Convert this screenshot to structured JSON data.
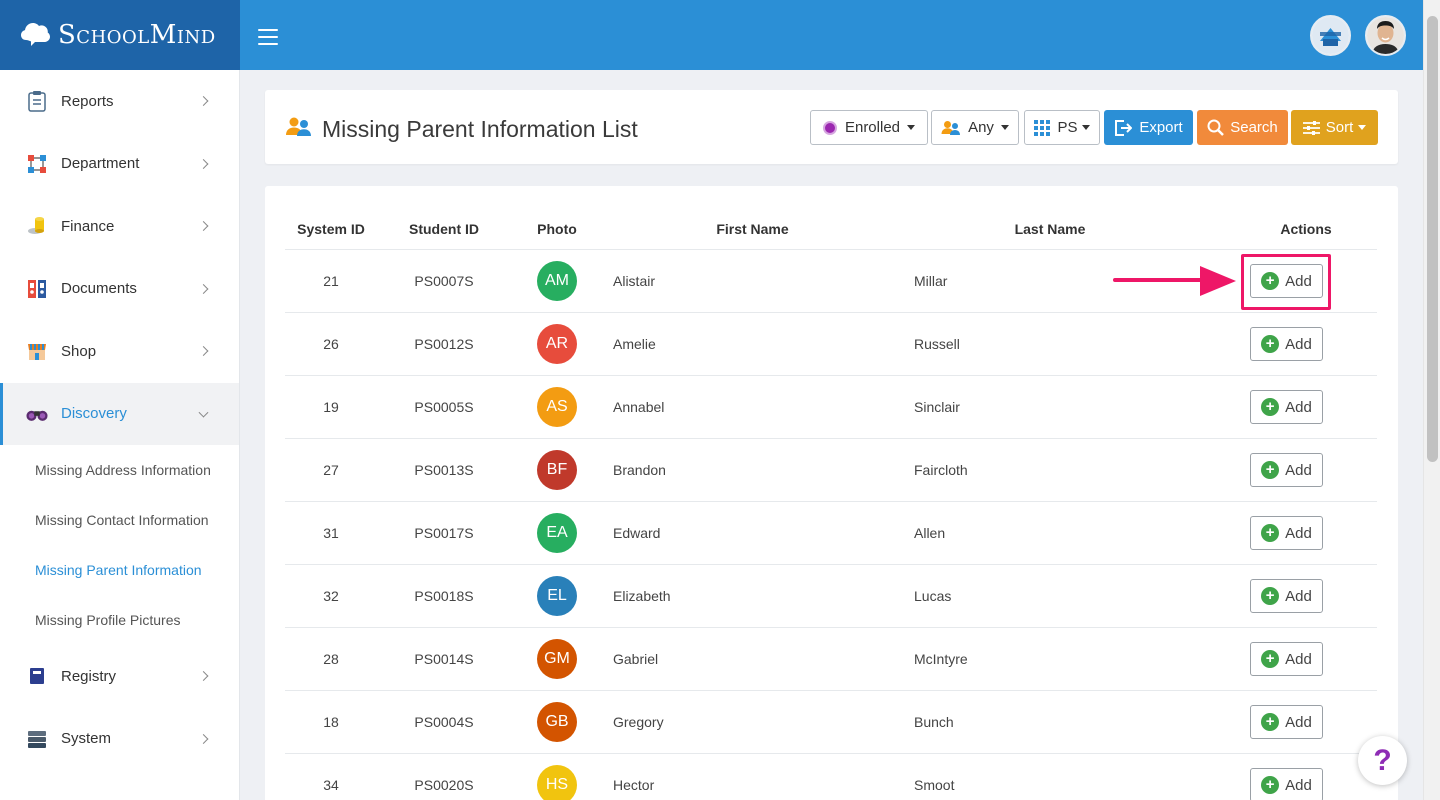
{
  "app": {
    "logo_text": "SchoolMind"
  },
  "sidebar": {
    "items": [
      {
        "label": "Reports",
        "icon": "clipboard-icon"
      },
      {
        "label": "Department",
        "icon": "department-icon"
      },
      {
        "label": "Finance",
        "icon": "coins-icon"
      },
      {
        "label": "Documents",
        "icon": "binders-icon"
      },
      {
        "label": "Shop",
        "icon": "shop-icon"
      },
      {
        "label": "Discovery",
        "icon": "binoculars-icon",
        "expanded": true
      },
      {
        "label": "Registry",
        "icon": "book-icon"
      },
      {
        "label": "System",
        "icon": "server-icon"
      }
    ],
    "discovery_sub": [
      "Missing Address Information",
      "Missing Contact Information",
      "Missing Parent Information",
      "Missing Profile Pictures"
    ]
  },
  "header": {
    "title": "Missing Parent Information List",
    "filters": {
      "status": "Enrolled",
      "any": "Any",
      "grade": "PS"
    },
    "export_label": "Export",
    "search_label": "Search",
    "sort_label": "Sort"
  },
  "table": {
    "columns": [
      "System ID",
      "Student ID",
      "Photo",
      "First Name",
      "Last Name",
      "Actions"
    ],
    "action_label": "Add",
    "rows": [
      {
        "system_id": "21",
        "student_id": "PS0007S",
        "initials": "AM",
        "color": "#27ae60",
        "first": "Alistair",
        "last": "Millar"
      },
      {
        "system_id": "26",
        "student_id": "PS0012S",
        "initials": "AR",
        "color": "#e74c3c",
        "first": "Amelie",
        "last": "Russell"
      },
      {
        "system_id": "19",
        "student_id": "PS0005S",
        "initials": "AS",
        "color": "#f39c12",
        "first": "Annabel",
        "last": "Sinclair"
      },
      {
        "system_id": "27",
        "student_id": "PS0013S",
        "initials": "BF",
        "color": "#c0392b",
        "first": "Brandon",
        "last": "Faircloth"
      },
      {
        "system_id": "31",
        "student_id": "PS0017S",
        "initials": "EA",
        "color": "#27ae60",
        "first": "Edward",
        "last": "Allen"
      },
      {
        "system_id": "32",
        "student_id": "PS0018S",
        "initials": "EL",
        "color": "#2980b9",
        "first": "Elizabeth",
        "last": "Lucas"
      },
      {
        "system_id": "28",
        "student_id": "PS0014S",
        "initials": "GM",
        "color": "#d35400",
        "first": "Gabriel",
        "last": "McIntyre"
      },
      {
        "system_id": "18",
        "student_id": "PS0004S",
        "initials": "GB",
        "color": "#d35400",
        "first": "Gregory",
        "last": "Bunch"
      },
      {
        "system_id": "34",
        "student_id": "PS0020S",
        "initials": "HS",
        "color": "#f1c40f",
        "first": "Hector",
        "last": "Smoot"
      }
    ]
  },
  "help_label": "?"
}
